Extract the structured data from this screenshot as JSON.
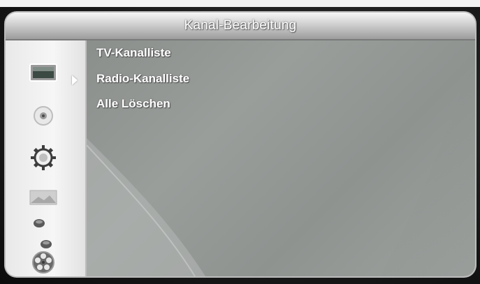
{
  "title": "Kanal-Bearbeitung",
  "menu": {
    "items": [
      {
        "label": "TV-Kanalliste"
      },
      {
        "label": "Radio-Kanalliste"
      },
      {
        "label": "Alle Löschen"
      }
    ]
  },
  "sidebar": {
    "icons": [
      "tv-icon",
      "disc-icon",
      "settings-gear-icon",
      "picture-icon",
      "sphere-pair-icon",
      "film-reel-icon"
    ],
    "selected_index": 0
  },
  "colors": {
    "menu_background": "#959995",
    "sidebar_background": "#efefef",
    "title_bar": "#c8c8c8",
    "text": "#ffffff"
  }
}
